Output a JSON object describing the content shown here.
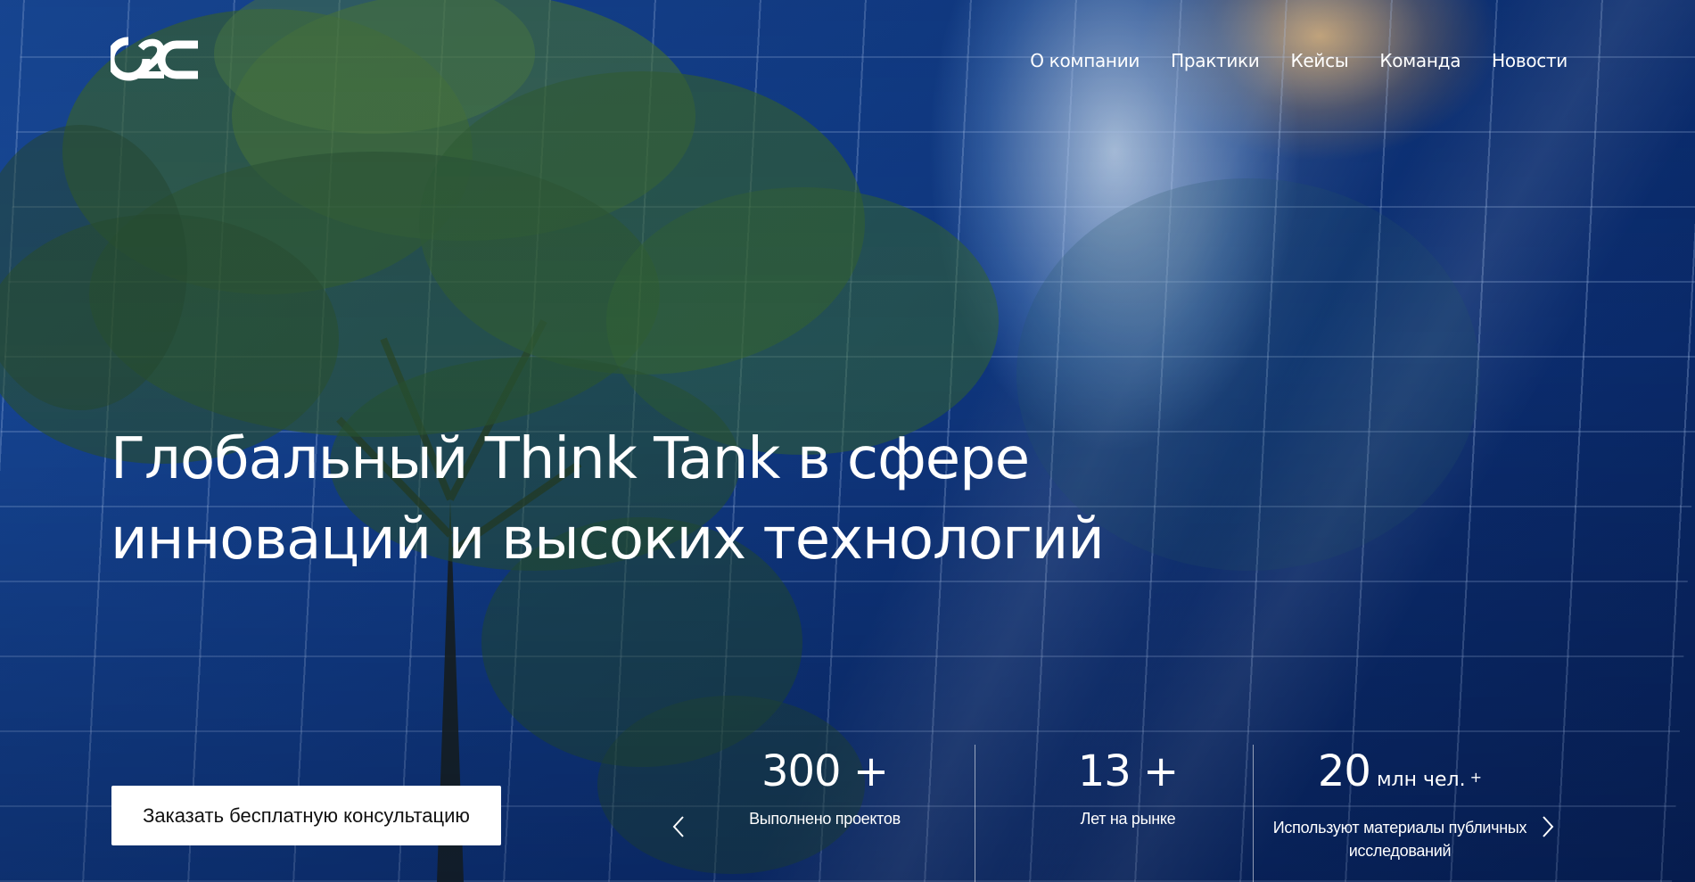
{
  "nav": {
    "items": [
      {
        "label": "О компании"
      },
      {
        "label": "Практики"
      },
      {
        "label": "Кейсы"
      },
      {
        "label": "Команда"
      },
      {
        "label": "Новости"
      }
    ]
  },
  "hero": {
    "headline_line1": "Глобальный Think Tank в сфере",
    "headline_line2": "инноваций и высоких технологий",
    "cta_label": "Заказать бесплатную консультацию"
  },
  "stats": [
    {
      "value": "300 +",
      "unit": "",
      "suffix": "",
      "label_line1": "Выполнено проектов",
      "label_line2": ""
    },
    {
      "value": "13 +",
      "unit": "",
      "suffix": "",
      "label_line1": "Лет на рынке",
      "label_line2": ""
    },
    {
      "value": "20",
      "unit": " млн чел.",
      "suffix": " +",
      "label_line1": "Используют материалы публичных",
      "label_line2": "исследований"
    }
  ],
  "icons": {
    "logo": "o2c-logo",
    "prev": "chevron-left-icon",
    "next": "chevron-right-icon"
  },
  "colors": {
    "text": "#ffffff",
    "button_bg": "#ffffff",
    "button_text": "#111111",
    "background": "#0b2a66"
  }
}
